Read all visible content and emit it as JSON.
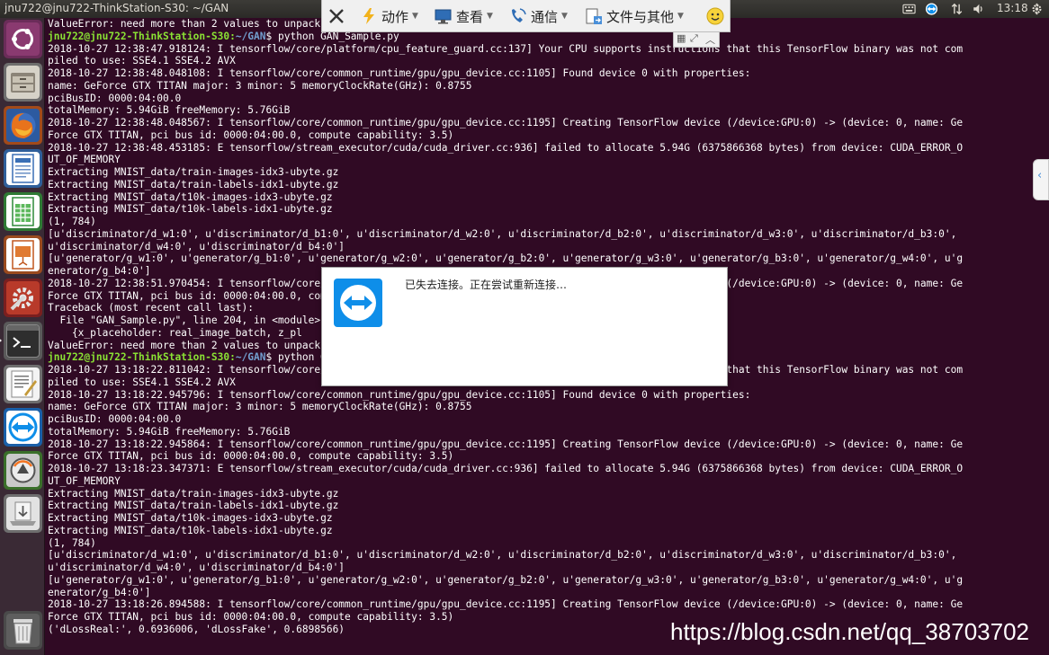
{
  "window": {
    "title": "jnu722@jnu722-ThinkStation-S30: ~/GAN"
  },
  "tray": {
    "time": "13:18",
    "icons": [
      "keyboard-icon",
      "teamviewer-icon",
      "network-icon",
      "volume-icon",
      "gear-icon"
    ]
  },
  "launcher": {
    "items": [
      {
        "name": "ubuntu-dash-icon"
      },
      {
        "name": "files-icon"
      },
      {
        "name": "firefox-icon"
      },
      {
        "name": "libreoffice-writer-icon"
      },
      {
        "name": "libreoffice-calc-icon"
      },
      {
        "name": "libreoffice-impress-icon"
      },
      {
        "name": "system-settings-icon"
      },
      {
        "name": "terminal-icon"
      },
      {
        "name": "text-editor-icon"
      },
      {
        "name": "teamviewer-icon"
      },
      {
        "name": "software-updater-icon"
      },
      {
        "name": "usb-creator-icon"
      },
      {
        "name": "trash-icon"
      }
    ]
  },
  "teamviewer_toolbar": {
    "close_icon": "close-icon",
    "actions_label": "动作",
    "view_label": "查看",
    "communicate_label": "通信",
    "files_label": "文件与其他",
    "smiley_icon": "smiley-icon"
  },
  "dialog": {
    "message": "已失去连接。正在尝试重新连接…"
  },
  "terminal": {
    "lines": [
      {
        "text": "ValueError: need more than 2 values to unpack"
      },
      {
        "user": "jnu722@jnu722-ThinkStation-S30",
        "path": "~/GAN",
        "cmd": "$ python GAN_Sample.py"
      },
      {
        "text": "2018-10-27 12:38:47.918124: I tensorflow/core/platform/cpu_feature_guard.cc:137] Your CPU supports instructions that this TensorFlow binary was not com"
      },
      {
        "text": "piled to use: SSE4.1 SSE4.2 AVX"
      },
      {
        "text": "2018-10-27 12:38:48.048108: I tensorflow/core/common_runtime/gpu/gpu_device.cc:1105] Found device 0 with properties:"
      },
      {
        "text": "name: GeForce GTX TITAN major: 3 minor: 5 memoryClockRate(GHz): 0.8755"
      },
      {
        "text": "pciBusID: 0000:04:00.0"
      },
      {
        "text": "totalMemory: 5.94GiB freeMemory: 5.76GiB"
      },
      {
        "text": "2018-10-27 12:38:48.048567: I tensorflow/core/common_runtime/gpu/gpu_device.cc:1195] Creating TensorFlow device (/device:GPU:0) -> (device: 0, name: Ge"
      },
      {
        "text": "Force GTX TITAN, pci bus id: 0000:04:00.0, compute capability: 3.5)"
      },
      {
        "text": "2018-10-27 12:38:48.453185: E tensorflow/stream_executor/cuda/cuda_driver.cc:936] failed to allocate 5.94G (6375866368 bytes) from device: CUDA_ERROR_O"
      },
      {
        "text": "UT_OF_MEMORY"
      },
      {
        "text": "Extracting MNIST_data/train-images-idx3-ubyte.gz"
      },
      {
        "text": "Extracting MNIST_data/train-labels-idx1-ubyte.gz"
      },
      {
        "text": "Extracting MNIST_data/t10k-images-idx3-ubyte.gz"
      },
      {
        "text": "Extracting MNIST_data/t10k-labels-idx1-ubyte.gz"
      },
      {
        "text": "(1, 784)"
      },
      {
        "text": "[u'discriminator/d_w1:0', u'discriminator/d_b1:0', u'discriminator/d_w2:0', u'discriminator/d_b2:0', u'discriminator/d_w3:0', u'discriminator/d_b3:0',"
      },
      {
        "text": "u'discriminator/d_w4:0', u'discriminator/d_b4:0']"
      },
      {
        "text": "[u'generator/g_w1:0', u'generator/g_b1:0', u'generator/g_w2:0', u'generator/g_b2:0', u'generator/g_w3:0', u'generator/g_b3:0', u'generator/g_w4:0', u'g"
      },
      {
        "text": "enerator/g_b4:0']"
      },
      {
        "text": "2018-10-27 12:38:51.970454: I tensorflow/core/common_runtime/gpu/gpu_device.cc:1195] Creating TensorFlow device (/device:GPU:0) -> (device: 0, name: Ge"
      },
      {
        "text": "Force GTX TITAN, pci bus id: 0000:04:00.0, compute capability: 3.5)"
      },
      {
        "text": "Traceback (most recent call last):"
      },
      {
        "text": "  File \"GAN_Sample.py\", line 204, in <module>"
      },
      {
        "text": "    {x_placeholder: real_image_batch, z_pl"
      },
      {
        "text": "ValueError: need more than 2 values to unpack"
      },
      {
        "user": "jnu722@jnu722-ThinkStation-S30",
        "path": "~/GAN",
        "cmd": "$ python GAN_Sample.py"
      },
      {
        "text": "2018-10-27 13:18:22.811042: I tensorflow/core/platform/cpu_feature_guard.cc:137] Your CPU supports instructions that this TensorFlow binary was not com"
      },
      {
        "text": "piled to use: SSE4.1 SSE4.2 AVX"
      },
      {
        "text": "2018-10-27 13:18:22.945796: I tensorflow/core/common_runtime/gpu/gpu_device.cc:1105] Found device 0 with properties:"
      },
      {
        "text": "name: GeForce GTX TITAN major: 3 minor: 5 memoryClockRate(GHz): 0.8755"
      },
      {
        "text": "pciBusID: 0000:04:00.0"
      },
      {
        "text": "totalMemory: 5.94GiB freeMemory: 5.76GiB"
      },
      {
        "text": "2018-10-27 13:18:22.945864: I tensorflow/core/common_runtime/gpu/gpu_device.cc:1195] Creating TensorFlow device (/device:GPU:0) -> (device: 0, name: Ge"
      },
      {
        "text": "Force GTX TITAN, pci bus id: 0000:04:00.0, compute capability: 3.5)"
      },
      {
        "text": "2018-10-27 13:18:23.347371: E tensorflow/stream_executor/cuda/cuda_driver.cc:936] failed to allocate 5.94G (6375866368 bytes) from device: CUDA_ERROR_O"
      },
      {
        "text": "UT_OF_MEMORY"
      },
      {
        "text": "Extracting MNIST_data/train-images-idx3-ubyte.gz"
      },
      {
        "text": "Extracting MNIST_data/train-labels-idx1-ubyte.gz"
      },
      {
        "text": "Extracting MNIST_data/t10k-images-idx3-ubyte.gz"
      },
      {
        "text": "Extracting MNIST_data/t10k-labels-idx1-ubyte.gz"
      },
      {
        "text": "(1, 784)"
      },
      {
        "text": "[u'discriminator/d_w1:0', u'discriminator/d_b1:0', u'discriminator/d_w2:0', u'discriminator/d_b2:0', u'discriminator/d_w3:0', u'discriminator/d_b3:0',"
      },
      {
        "text": "u'discriminator/d_w4:0', u'discriminator/d_b4:0']"
      },
      {
        "text": "[u'generator/g_w1:0', u'generator/g_b1:0', u'generator/g_w2:0', u'generator/g_b2:0', u'generator/g_w3:0', u'generator/g_b3:0', u'generator/g_w4:0', u'g"
      },
      {
        "text": "enerator/g_b4:0']"
      },
      {
        "text": "2018-10-27 13:18:26.894588: I tensorflow/core/common_runtime/gpu/gpu_device.cc:1195] Creating TensorFlow device (/device:GPU:0) -> (device: 0, name: Ge"
      },
      {
        "text": "Force GTX TITAN, pci bus id: 0000:04:00.0, compute capability: 3.5)"
      },
      {
        "text": "('dLossReal:', 0.6936006, 'dLossFake', 0.6898566)"
      }
    ]
  },
  "watermark": "https://blog.csdn.net/qq_38703702",
  "colors": {
    "terminal_bg": "#300a24",
    "prompt_user": "#8ae234",
    "prompt_path": "#729fcf",
    "teamviewer_blue": "#0e8ee9"
  }
}
